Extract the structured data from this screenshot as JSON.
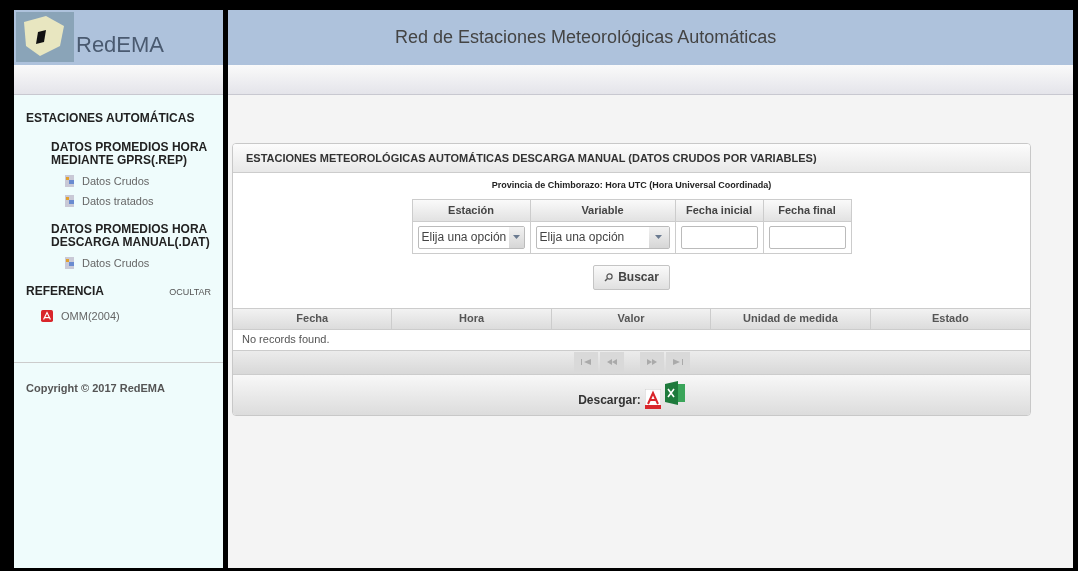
{
  "brand": {
    "name": "RedEMA"
  },
  "header": {
    "title": "Red de Estaciones Meteorológicas Automáticas"
  },
  "sidebar": {
    "heading": "ESTACIONES AUTOMÁTICAS",
    "groups": [
      {
        "title": "DATOS PROMEDIOS HORA MEDIANTE GPRS(.REP)",
        "items": [
          "Datos Crudos",
          "Datos tratados"
        ]
      },
      {
        "title": "DATOS PROMEDIOS HORA DESCARGA MANUAL(.DAT)",
        "items": [
          "Datos Crudos"
        ]
      }
    ],
    "reference": {
      "heading": "REFERENCIA",
      "toggle": "OCULTAR",
      "items": [
        "OMM(2004)"
      ]
    },
    "copyright": "Copyright © 2017 RedEMA"
  },
  "panel": {
    "title": "ESTACIONES METEOROLÓGICAS AUTOMÁTICAS DESCARGA MANUAL (DATOS CRUDOS POR VARIABLES)",
    "subtitle": "Provincia de Chimborazo: Hora UTC (Hora Universal Coordinada)",
    "filters": [
      {
        "kind": "select",
        "label": "Estación",
        "placeholder": "Elija una opción"
      },
      {
        "kind": "select",
        "label": "Variable",
        "placeholder": "Elija una opción"
      },
      {
        "kind": "date",
        "label": "Fecha inicial"
      },
      {
        "kind": "date",
        "label": "Fecha final"
      }
    ],
    "search_button": "Buscar",
    "table": {
      "columns": [
        "Fecha",
        "Hora",
        "Valor",
        "Unidad de medida",
        "Estado"
      ],
      "empty_message": "No records found."
    },
    "download_label": "Descargar:"
  }
}
